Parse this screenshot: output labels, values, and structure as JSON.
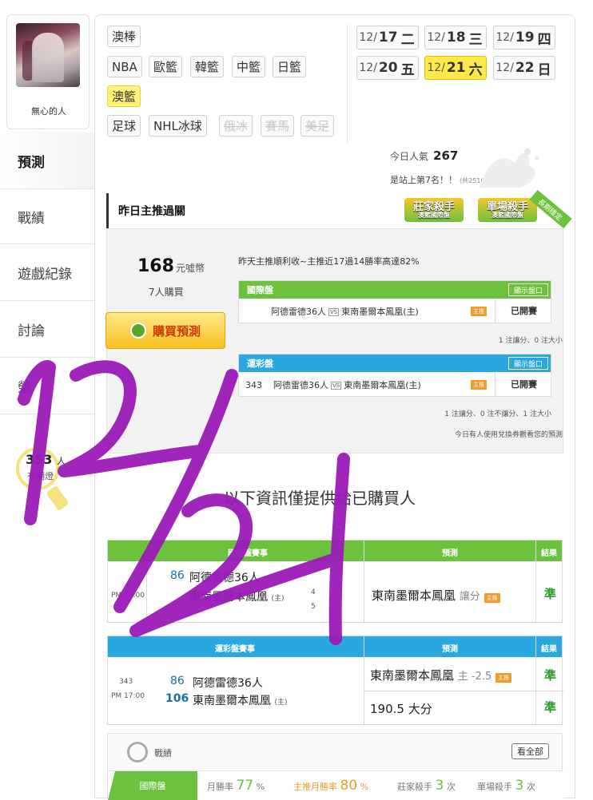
{
  "profile": {
    "username": "無心的人"
  },
  "nav": [
    "預測",
    "戰績",
    "遊戲紀錄",
    "討論",
    "榮"
  ],
  "hint": {
    "count": "353",
    "unit": "人",
    "text": "有明燈"
  },
  "categories": [
    "澳棒",
    "NBA",
    "歐籃",
    "韓籃",
    "中籃",
    "日籃",
    "澳籃",
    "足球",
    "NHL冰球",
    "俄冰",
    "賽馬",
    "美足"
  ],
  "dates": [
    {
      "md": "12/",
      "day": "17",
      "dow": "二"
    },
    {
      "md": "12/",
      "day": "18",
      "dow": "三"
    },
    {
      "md": "12/",
      "day": "19",
      "dow": "四"
    },
    {
      "md": "12/",
      "day": "20",
      "dow": "五"
    },
    {
      "md": "12/",
      "day": "21",
      "dow": "六"
    },
    {
      "md": "12/",
      "day": "22",
      "dow": "日"
    }
  ],
  "popularity": {
    "label": "今日人氣",
    "value": "267",
    "rank": "是站上第7名！！",
    "total": "(共2516人)"
  },
  "yesterday": {
    "title": "昨日主推過關",
    "badge1": "莊家殺手",
    "badge1_sub": "澳籃國際盤",
    "badge2": "單場殺手",
    "badge2_sub": "澳籃國際盤",
    "ribbon": "長期穩定",
    "price": "168",
    "price_unit": "元噓幣",
    "buyers": "7人購買",
    "buy_label": "購買預測",
    "summary": "昨天主推順利收~主推近17過14勝率高達82%",
    "intl": {
      "head": "國際盤",
      "show": "顯示盤口",
      "teams": "阿德雷德36人",
      "vs": "VS",
      "home": "東南墨爾本鳳凰(主)",
      "tag": "主推",
      "state": "已開賽",
      "note": "1 注讓分、0 注大小"
    },
    "sport": {
      "head": "運彩盤",
      "show": "顯示盤口",
      "num": "343",
      "teams": "阿德雷德36人",
      "vs": "VS",
      "home": "東南墨爾本鳳凰(主)",
      "tag": "主推",
      "state": "已開賽",
      "note": "1 注讓分、0 注不讓分、1 注大小",
      "note2": "今日有人使用兌換券觀看您的預測"
    }
  },
  "info_title": "以下資訊僅提供給已購買人",
  "table_intl": {
    "h1": "國際盤賽事",
    "h2": "預測",
    "h3": "結果",
    "time": "PM 17:00",
    "num": "86",
    "away": "阿德雷德36人",
    "home": "東南墨爾本鳳凰",
    "home_tag": "(主)",
    "line1": "4",
    "line2": "5",
    "pick": "東南墨爾本鳳凰",
    "pick_type": "讓分",
    "tag": "主推",
    "result": "準"
  },
  "table_sport": {
    "h1": "運彩盤賽事",
    "h2": "預測",
    "h3": "結果",
    "code": "343",
    "time": "PM 17:00",
    "num1": "86",
    "away": "阿德雷德36人",
    "num2": "106",
    "home": "東南墨爾本鳳凰",
    "home_tag": "(主)",
    "pick1": "東南墨爾本鳳凰",
    "pick1_line": "主 -2.5",
    "tag": "主推",
    "result1": "準",
    "pick2": "190.5 大分",
    "result2": "準"
  },
  "stats": {
    "title": "戰績",
    "see_all": "看全部",
    "tab": "國際盤",
    "s1_label": "月勝率",
    "s1_value": "77",
    "s1_unit": "%",
    "s2_label": "主推月勝率",
    "s2_value": "80",
    "s2_unit": "%",
    "s3_label": "莊家殺手",
    "s3_value": "3",
    "s3_unit": "次",
    "s4_label": "單場殺手",
    "s4_value": "3",
    "s4_unit": "次"
  },
  "overlay_note": "12/21",
  "colors": {
    "green": "#6cc23c",
    "blue": "#29a8e0",
    "highlight": "#ffe94a",
    "ink": "#9b1bb8"
  }
}
